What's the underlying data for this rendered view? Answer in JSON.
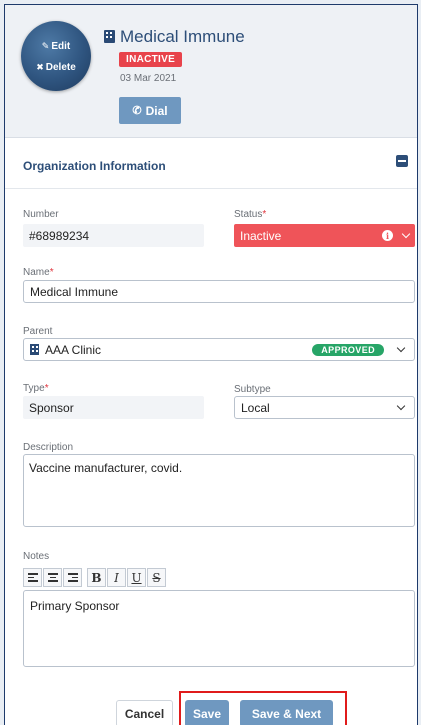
{
  "header": {
    "avatar_edit": "Edit",
    "avatar_delete": "Delete",
    "title": "Medical Immune",
    "status": "INACTIVE",
    "date": "03 Mar 2021",
    "dial": "Dial"
  },
  "section": {
    "title": "Organization Information"
  },
  "fields": {
    "number_label": "Number",
    "number_value": "#68989234",
    "status_label": "Status",
    "status_value": "Inactive",
    "name_label": "Name",
    "name_value": "Medical Immune",
    "parent_label": "Parent",
    "parent_value": "AAA Clinic",
    "parent_badge": "APPROVED",
    "type_label": "Type",
    "type_value": "Sponsor",
    "subtype_label": "Subtype",
    "subtype_value": "Local",
    "description_label": "Description",
    "description_value": "Vaccine manufacturer, covid.",
    "notes_label": "Notes",
    "notes_value": "Primary Sponsor",
    "required_mark": "*"
  },
  "toolbar": {
    "bold": "B",
    "italic": "I",
    "underline": "U",
    "strike": "S"
  },
  "footer": {
    "cancel": "Cancel",
    "save": "Save",
    "save_next": "Save & Next"
  },
  "colors": {
    "accent": "#6f98c0",
    "title": "#2d4e78",
    "danger": "#ef5459",
    "approved": "#27a567",
    "highlight": "#e01b1b"
  }
}
